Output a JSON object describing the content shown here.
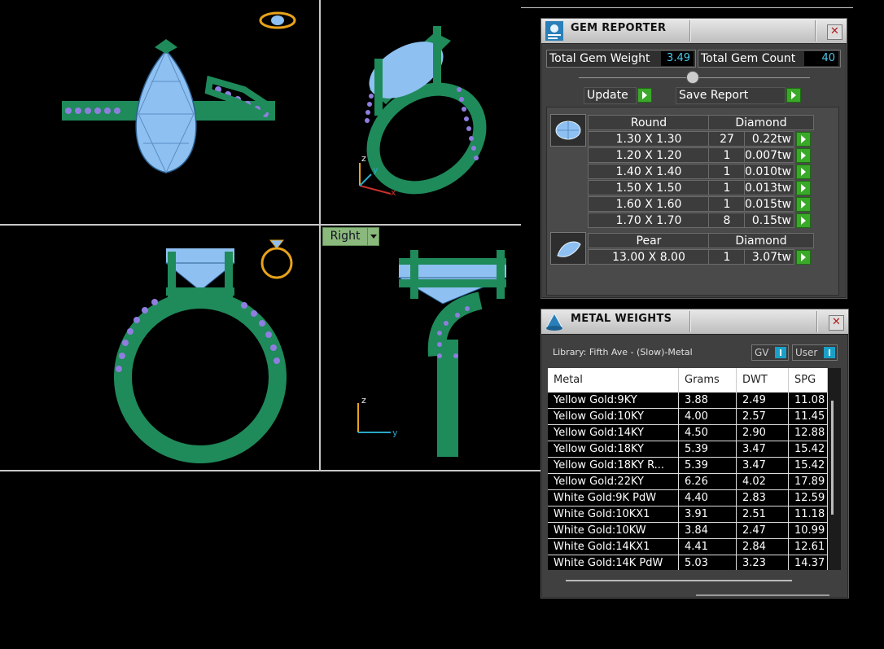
{
  "viewports": {
    "active_view_label": "Right",
    "axis_labels": {
      "z": "z",
      "y": "y",
      "x": "x"
    }
  },
  "gem_reporter": {
    "title": "GEM REPORTER",
    "close": "✕",
    "total_weight_label": "Total Gem Weight",
    "total_weight_value": "3.49",
    "total_count_label": "Total Gem Count",
    "total_count_value": "40",
    "update_label": "Update",
    "save_label": "Save Report",
    "groups": [
      {
        "shape": "Round",
        "material": "Diamond",
        "rows": [
          {
            "size": "1.30 X 1.30",
            "qty": "27",
            "weight": "0.22tw"
          },
          {
            "size": "1.20 X 1.20",
            "qty": "1",
            "weight": "0.007tw"
          },
          {
            "size": "1.40 X 1.40",
            "qty": "1",
            "weight": "0.010tw"
          },
          {
            "size": "1.50 X 1.50",
            "qty": "1",
            "weight": "0.013tw"
          },
          {
            "size": "1.60 X 1.60",
            "qty": "1",
            "weight": "0.015tw"
          },
          {
            "size": "1.70 X 1.70",
            "qty": "8",
            "weight": "0.15tw"
          }
        ]
      },
      {
        "shape": "Pear",
        "material": "Diamond",
        "rows": [
          {
            "size": "13.00 X 8.00",
            "qty": "1",
            "weight": "3.07tw"
          }
        ]
      }
    ]
  },
  "metal_weights": {
    "title": "METAL WEIGHTS",
    "close": "✕",
    "library": "Library: Fifth Ave - (Slow)-Metal",
    "toggle_gv": "GV",
    "toggle_user": "User",
    "columns": [
      "Metal",
      "Grams",
      "DWT",
      "SPG"
    ],
    "rows": [
      [
        "Yellow Gold:9KY",
        "3.88",
        "2.49",
        "11.08"
      ],
      [
        "Yellow Gold:10KY",
        "4.00",
        "2.57",
        "11.45"
      ],
      [
        "Yellow Gold:14KY",
        "4.50",
        "2.90",
        "12.88"
      ],
      [
        "Yellow Gold:18KY",
        "5.39",
        "3.47",
        "15.42"
      ],
      [
        "Yellow Gold:18KY R...",
        "5.39",
        "3.47",
        "15.42"
      ],
      [
        "Yellow Gold:22KY",
        "6.26",
        "4.02",
        "17.89"
      ],
      [
        "White Gold:9K PdW",
        "4.40",
        "2.83",
        "12.59"
      ],
      [
        "White Gold:10KX1",
        "3.91",
        "2.51",
        "11.18"
      ],
      [
        "White Gold:10KW",
        "3.84",
        "2.47",
        "10.99"
      ],
      [
        "White Gold:14KX1",
        "4.41",
        "2.84",
        "12.61"
      ],
      [
        "White Gold:14K PdW",
        "5.03",
        "3.23",
        "14.37"
      ]
    ]
  }
}
